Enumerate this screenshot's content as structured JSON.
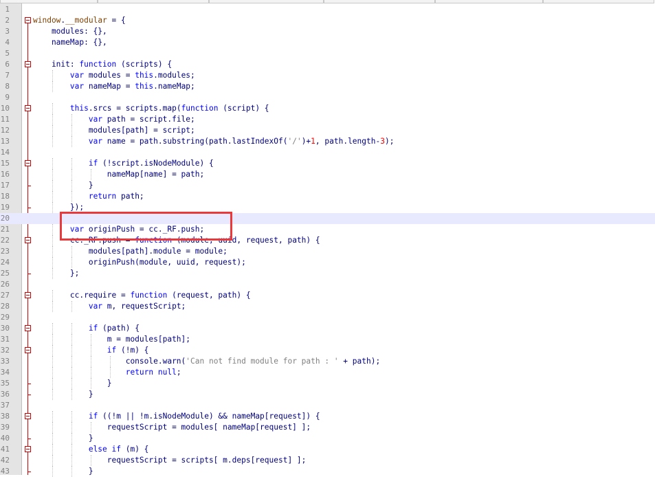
{
  "editor": {
    "current_line": 20,
    "highlight_color": "#e8e8ff",
    "annotation_color": "#e83a3a",
    "lines": [
      {
        "n": "1",
        "tokens": []
      },
      {
        "n": "2",
        "tokens": [
          [
            "glob",
            "window"
          ],
          [
            "id",
            "."
          ],
          [
            "glob",
            "__modular"
          ],
          [
            "id",
            " = {"
          ]
        ]
      },
      {
        "n": "3",
        "tokens": [
          [
            "id",
            "    modules: {},"
          ]
        ]
      },
      {
        "n": "4",
        "tokens": [
          [
            "id",
            "    nameMap: {},"
          ]
        ]
      },
      {
        "n": "5",
        "tokens": []
      },
      {
        "n": "6",
        "tokens": [
          [
            "id",
            "    init: "
          ],
          [
            "kw",
            "function"
          ],
          [
            "id",
            " (scripts) {"
          ]
        ]
      },
      {
        "n": "7",
        "tokens": [
          [
            "id",
            "        "
          ],
          [
            "kw",
            "var"
          ],
          [
            "id",
            " modules = "
          ],
          [
            "kw",
            "this"
          ],
          [
            "id",
            ".modules;"
          ]
        ]
      },
      {
        "n": "8",
        "tokens": [
          [
            "id",
            "        "
          ],
          [
            "kw",
            "var"
          ],
          [
            "id",
            " nameMap = "
          ],
          [
            "kw",
            "this"
          ],
          [
            "id",
            ".nameMap;"
          ]
        ]
      },
      {
        "n": "9",
        "tokens": []
      },
      {
        "n": "10",
        "tokens": [
          [
            "id",
            "        "
          ],
          [
            "kw",
            "this"
          ],
          [
            "id",
            ".srcs = scripts.map("
          ],
          [
            "kw",
            "function"
          ],
          [
            "id",
            " (script) {"
          ]
        ]
      },
      {
        "n": "11",
        "tokens": [
          [
            "id",
            "            "
          ],
          [
            "kw",
            "var"
          ],
          [
            "id",
            " path = script.file;"
          ]
        ]
      },
      {
        "n": "12",
        "tokens": [
          [
            "id",
            "            modules[path] = script;"
          ]
        ]
      },
      {
        "n": "13",
        "tokens": [
          [
            "id",
            "            "
          ],
          [
            "kw",
            "var"
          ],
          [
            "id",
            " name = path.substring(path.lastIndexOf("
          ],
          [
            "str",
            "'/'"
          ],
          [
            "id",
            ")+"
          ],
          [
            "num",
            "1"
          ],
          [
            "id",
            ", path.length-"
          ],
          [
            "num",
            "3"
          ],
          [
            "id",
            ");"
          ]
        ]
      },
      {
        "n": "14",
        "tokens": []
      },
      {
        "n": "15",
        "tokens": [
          [
            "id",
            "            "
          ],
          [
            "kw",
            "if"
          ],
          [
            "id",
            " (!script.isNodeModule) {"
          ]
        ]
      },
      {
        "n": "16",
        "tokens": [
          [
            "id",
            "                nameMap[name] = path;"
          ]
        ]
      },
      {
        "n": "17",
        "tokens": [
          [
            "id",
            "            }"
          ]
        ]
      },
      {
        "n": "18",
        "tokens": [
          [
            "id",
            "            "
          ],
          [
            "kw",
            "return"
          ],
          [
            "id",
            " path;"
          ]
        ]
      },
      {
        "n": "19",
        "tokens": [
          [
            "id",
            "        });"
          ]
        ]
      },
      {
        "n": "20",
        "tokens": []
      },
      {
        "n": "21",
        "tokens": [
          [
            "id",
            "        "
          ],
          [
            "kw",
            "var"
          ],
          [
            "id",
            " originPush = cc._RF.push;"
          ]
        ]
      },
      {
        "n": "22",
        "tokens": [
          [
            "id",
            "        cc._RF.push = "
          ],
          [
            "kw",
            "function"
          ],
          [
            "id",
            " (module, uuid, request, path) {"
          ]
        ]
      },
      {
        "n": "23",
        "tokens": [
          [
            "id",
            "            modules[path].module = module;"
          ]
        ]
      },
      {
        "n": "24",
        "tokens": [
          [
            "id",
            "            originPush(module, uuid, request);"
          ]
        ]
      },
      {
        "n": "25",
        "tokens": [
          [
            "id",
            "        };"
          ]
        ]
      },
      {
        "n": "26",
        "tokens": []
      },
      {
        "n": "27",
        "tokens": [
          [
            "id",
            "        cc.require = "
          ],
          [
            "kw",
            "function"
          ],
          [
            "id",
            " (request, path) {"
          ]
        ]
      },
      {
        "n": "28",
        "tokens": [
          [
            "id",
            "            "
          ],
          [
            "kw",
            "var"
          ],
          [
            "id",
            " m, requestScript;"
          ]
        ]
      },
      {
        "n": "29",
        "tokens": []
      },
      {
        "n": "30",
        "tokens": [
          [
            "id",
            "            "
          ],
          [
            "kw",
            "if"
          ],
          [
            "id",
            " (path) {"
          ]
        ]
      },
      {
        "n": "31",
        "tokens": [
          [
            "id",
            "                m = modules[path];"
          ]
        ]
      },
      {
        "n": "32",
        "tokens": [
          [
            "id",
            "                "
          ],
          [
            "kw",
            "if"
          ],
          [
            "id",
            " (!m) {"
          ]
        ]
      },
      {
        "n": "33",
        "tokens": [
          [
            "id",
            "                    console.warn("
          ],
          [
            "str",
            "'Can not find module for path : '"
          ],
          [
            "id",
            " + path);"
          ]
        ]
      },
      {
        "n": "34",
        "tokens": [
          [
            "id",
            "                    "
          ],
          [
            "kw",
            "return"
          ],
          [
            "id",
            " "
          ],
          [
            "kw",
            "null"
          ],
          [
            "id",
            ";"
          ]
        ]
      },
      {
        "n": "35",
        "tokens": [
          [
            "id",
            "                }"
          ]
        ]
      },
      {
        "n": "36",
        "tokens": [
          [
            "id",
            "            }"
          ]
        ]
      },
      {
        "n": "37",
        "tokens": []
      },
      {
        "n": "38",
        "tokens": [
          [
            "id",
            "            "
          ],
          [
            "kw",
            "if"
          ],
          [
            "id",
            " ((!m || !m.isNodeModule) && nameMap[request]) {"
          ]
        ]
      },
      {
        "n": "39",
        "tokens": [
          [
            "id",
            "                requestScript = modules[ nameMap[request] ];"
          ]
        ]
      },
      {
        "n": "40",
        "tokens": [
          [
            "id",
            "            }"
          ]
        ]
      },
      {
        "n": "41",
        "tokens": [
          [
            "id",
            "            "
          ],
          [
            "kw",
            "else if"
          ],
          [
            "id",
            " (m) {"
          ]
        ]
      },
      {
        "n": "42",
        "tokens": [
          [
            "id",
            "                requestScript = scripts[ m.deps[request] ];"
          ]
        ]
      },
      {
        "n": "43",
        "tokens": [
          [
            "id",
            "            }"
          ]
        ]
      }
    ],
    "fold_markers": [
      "2",
      "6",
      "10",
      "15",
      "22",
      "27",
      "30",
      "32",
      "38",
      "41"
    ]
  }
}
